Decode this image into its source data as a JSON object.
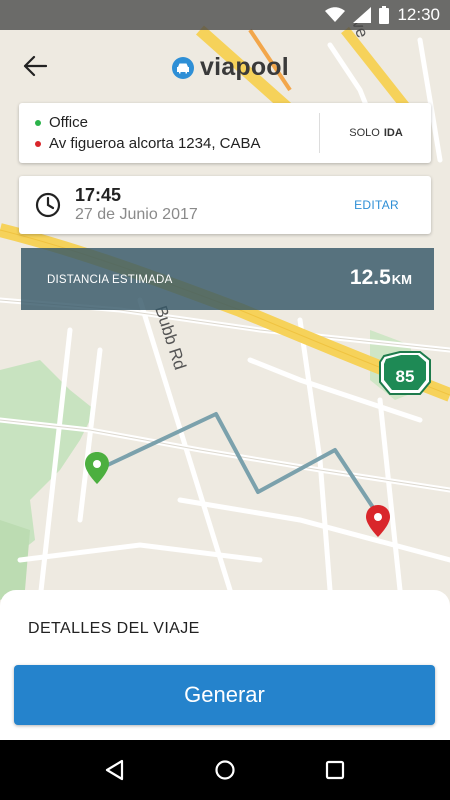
{
  "status_bar": {
    "time": "12:30"
  },
  "header": {
    "brand": "viapool"
  },
  "route": {
    "origin": "Office",
    "destination": "Av figueroa alcorta 1234, CABA",
    "origin_color": "#2bb34a",
    "destination_color": "#d9262b",
    "mode_prefix": "SOLO",
    "mode_value": "IDA"
  },
  "schedule": {
    "time": "17:45",
    "date": "27 de Junio 2017",
    "edit_label": "EDITAR"
  },
  "distance": {
    "label": "DISTANCIA ESTIMADA",
    "value": "12.5",
    "unit": "KM"
  },
  "map": {
    "street_name": "Bubb Rd",
    "highway_shield": "85",
    "partial_label": "ve"
  },
  "sheet": {
    "title": "DETALLES DEL VIAJE",
    "button_label": "Generar"
  },
  "colors": {
    "accent": "#2e8fd6",
    "button": "#2583cc",
    "distance_bar": "#365868",
    "route_line": "#6f96a1"
  }
}
